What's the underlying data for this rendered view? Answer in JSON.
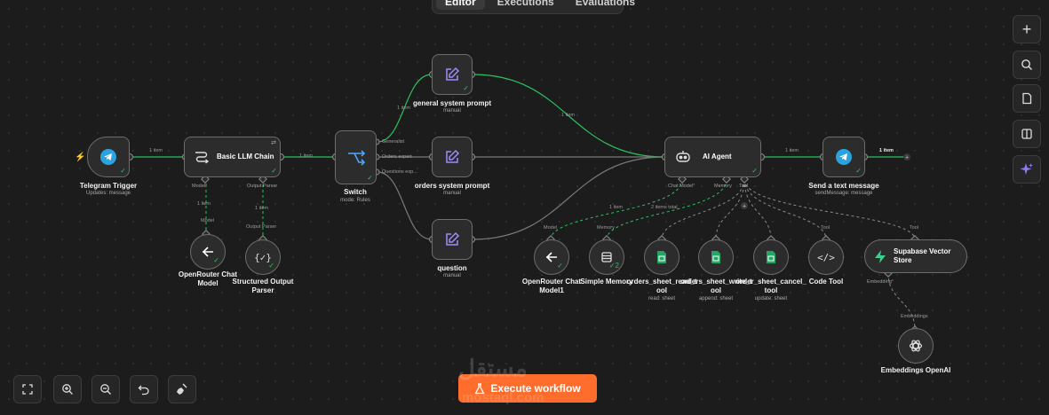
{
  "tabs": [
    "Editor",
    "Executions",
    "Evaluations"
  ],
  "right_toolbar": [
    "plus-icon",
    "search-icon",
    "sticky-note-icon",
    "panel-icon",
    "sparkle-icon"
  ],
  "bottom_toolbar": [
    "fit-view-icon",
    "zoom-in-icon",
    "zoom-out-icon",
    "undo-icon",
    "clean-up-icon"
  ],
  "execute_label": "Execute workflow",
  "watermark": {
    "arabic": "مستقل",
    "latin": "mostaql.com"
  },
  "nodes": {
    "telegram_trigger": {
      "title": "Telegram Trigger",
      "sub": "Updates: message"
    },
    "basic_llm": {
      "title": "Basic LLM Chain",
      "port_model": "Model",
      "port_parser": "Output Parser",
      "req": "*"
    },
    "openrouter": {
      "title": "OpenRouter Chat Model"
    },
    "structured": {
      "title": "Structured Output Parser"
    },
    "switch": {
      "title": "Switch",
      "sub": "mode: Rules",
      "out1": "Generalist",
      "out2": "Orders expert",
      "out3": "Questions exp..."
    },
    "general_prompt": {
      "title": "general system prompt",
      "sub": "manual"
    },
    "orders_prompt": {
      "title": "orders system prompt",
      "sub": "manual"
    },
    "question": {
      "title": "question",
      "sub": "manual"
    },
    "ai_agent": {
      "title": "AI Agent",
      "port_chat": "Chat Model",
      "port_memory": "Memory",
      "port_tool": "Tool",
      "req": "*"
    },
    "send_message": {
      "title": "Send a text message",
      "sub": "sendMessage: message"
    },
    "openrouter1": {
      "title": "OpenRouter Chat Model1"
    },
    "memory": {
      "title": "Simple Memory",
      "badge": "2"
    },
    "orders_read": {
      "title": "orders_sheet_read_t ool",
      "sub": "read: sheet"
    },
    "orders_write": {
      "title": "orders_sheet_write_t ool",
      "sub": "append: sheet"
    },
    "order_cancel": {
      "title": "order_sheet_cancel_ tool",
      "sub": "update: sheet"
    },
    "code_tool": {
      "title": "Code Tool"
    },
    "supabase": {
      "title": "Supabase Vector Store",
      "port_embedding": "Embedding",
      "req": "*"
    },
    "embeddings": {
      "title": "Embeddings OpenAI"
    }
  },
  "connection_labels": {
    "c1": "1 item",
    "c2": "1 item",
    "c3": "1 item",
    "c4": "1 item",
    "c5": "1 item",
    "c6": "1 item",
    "c7": "1 item",
    "c8": "1 item",
    "c9": "2 items total",
    "model": "Model",
    "output_parser": "Output Parser",
    "model2": "Model",
    "memory2": "Memory",
    "tool1": "Tool",
    "tool2": "Tool",
    "embeddings": "Embeddings"
  },
  "colors": {
    "accent": "#ff6d2d",
    "success": "#2ac35e",
    "dashed": "#2ac35e"
  }
}
